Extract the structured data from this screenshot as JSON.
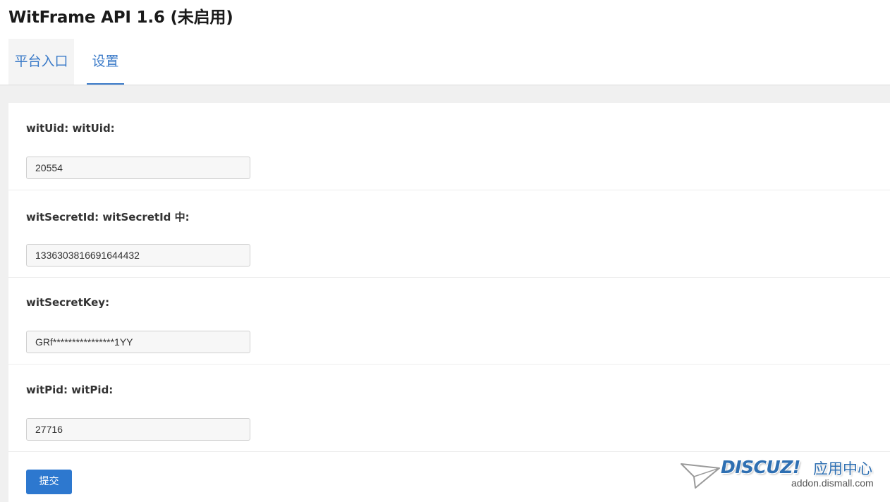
{
  "page": {
    "title": "WitFrame API 1.6 (未启用)"
  },
  "tabs": [
    {
      "label": "平台入口",
      "active": false
    },
    {
      "label": "设置",
      "active": true
    }
  ],
  "form": {
    "fields": [
      {
        "label": "witUid: witUid:",
        "value": "20554"
      },
      {
        "label": "witSecretId: witSecretId 中:",
        "value": "1336303816691644432"
      },
      {
        "label": "witSecretKey:",
        "value": "GRf****************1YY"
      },
      {
        "label": "witPid: witPid:",
        "value": "27716"
      }
    ],
    "submit_label": "提交"
  },
  "watermark": {
    "brand": "DISCUZ!",
    "cn": "应用中心",
    "url": "addon.dismall.com",
    "icon": "paper-plane-icon"
  },
  "colors": {
    "accent": "#3a7ac8",
    "button": "#2d78cf",
    "band": "#f0f0f0"
  }
}
